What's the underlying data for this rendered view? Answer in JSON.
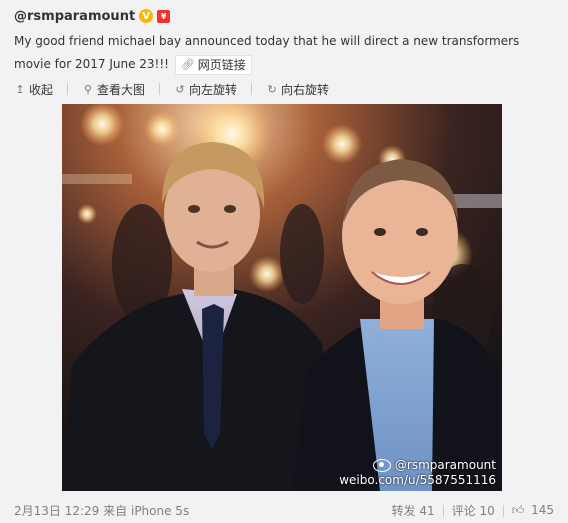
{
  "user": {
    "handle": "@rsmparamount",
    "verified_icon": "verified-v-icon",
    "badge_icon": "red-envelope-icon"
  },
  "post": {
    "text": "My good friend michael bay announced today that he will direct a new transformers movie for 2017 June 23!!!",
    "link_label": "网页链接",
    "link_icon": "link-icon"
  },
  "toolbar": {
    "collapse": "收起",
    "view_large": "查看大图",
    "rotate_left": "向左旋转",
    "rotate_right": "向右旋转"
  },
  "photo": {
    "watermark_handle": "@rsmparamount",
    "watermark_url": "weibo.com/u/5587551116"
  },
  "footer": {
    "date": "2月13日 12:29",
    "source_prefix": "来自",
    "source": "iPhone 5s",
    "repost_label": "转发",
    "repost_count": "41",
    "comment_label": "评论",
    "comment_count": "10",
    "like_count": "145"
  },
  "colors": {
    "page_bg": "#f2f2f5",
    "text": "#333333",
    "muted": "#808080",
    "verified": "#f6b800"
  }
}
